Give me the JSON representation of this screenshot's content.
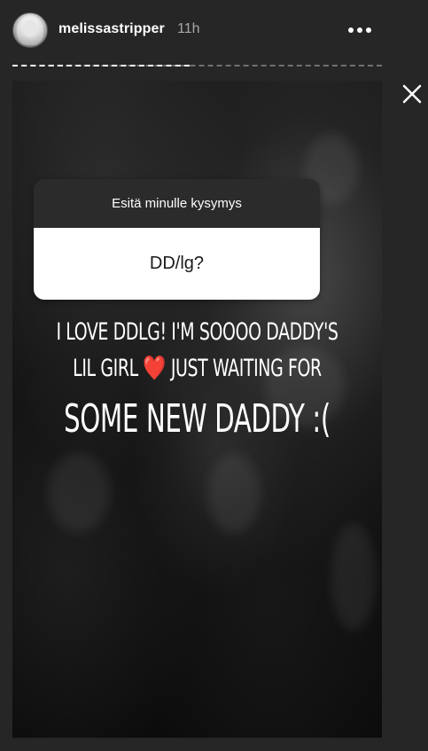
{
  "header": {
    "username": "melissastripper",
    "timestamp": "11h",
    "more_icon": "more-horizontal-icon",
    "close_icon": "close-icon"
  },
  "progress": {
    "fraction": 0.48
  },
  "question_sticker": {
    "prompt": "Esitä minulle kysymys",
    "question": "DD/lg?"
  },
  "story_text": {
    "line1": "I LOVE DDLG! I'M SOOOO DADDY'S",
    "line2_start": "LIL GIRL",
    "line2_emoji": "❤️",
    "line2_end": "JUST WAITING FOR",
    "line3": "SOME NEW DADDY :("
  },
  "colors": {
    "background": "#262626",
    "heart": "#e0242e"
  }
}
